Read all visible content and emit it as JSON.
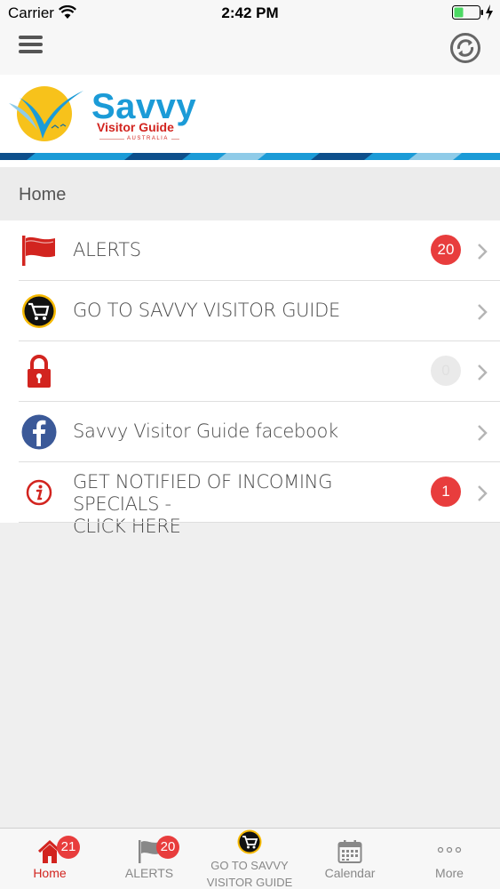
{
  "status_bar": {
    "carrier": "Carrier",
    "time": "2:42 PM"
  },
  "nav": {
    "menu_icon": "hamburger-icon",
    "refresh_icon": "refresh-icon"
  },
  "logo": {
    "title": "Savvy",
    "subtitle": "Visitor Guide",
    "country": "AUSTRALIA"
  },
  "breadcrumb": "Home",
  "menu_items": [
    {
      "icon": "flag-icon",
      "label": "ALERTS",
      "badge": "20"
    },
    {
      "icon": "cart-icon",
      "label": "GO TO SAVVY VISITOR GUIDE",
      "badge": ""
    },
    {
      "icon": "lock-icon",
      "label": "",
      "badge": "0"
    },
    {
      "icon": "facebook-icon",
      "label": "Savvy Visitor Guide facebook",
      "badge": ""
    },
    {
      "icon": "info-icon",
      "label_line1": "GET NOTIFIED OF INCOMING SPECIALS -",
      "label_line2": "CLICK HERE",
      "badge": "1"
    }
  ],
  "tabs": [
    {
      "icon": "home-icon",
      "label": "Home",
      "badge": "21",
      "active": true
    },
    {
      "icon": "flag-icon",
      "label": "ALERTS",
      "badge": "20",
      "active": false
    },
    {
      "icon": "cart-icon",
      "label_line1": "GO TO SAVVY",
      "label_line2": "VISITOR GUIDE",
      "badge": "",
      "active": false
    },
    {
      "icon": "calendar-icon",
      "label": "Calendar",
      "badge": "",
      "active": false
    },
    {
      "icon": "more-icon",
      "label": "More",
      "badge": "",
      "active": false
    }
  ],
  "colors": {
    "accent_red": "#d2241f",
    "badge_red": "#e83d3d",
    "brand_blue": "#1b9bd7",
    "facebook_blue": "#3b5998"
  }
}
